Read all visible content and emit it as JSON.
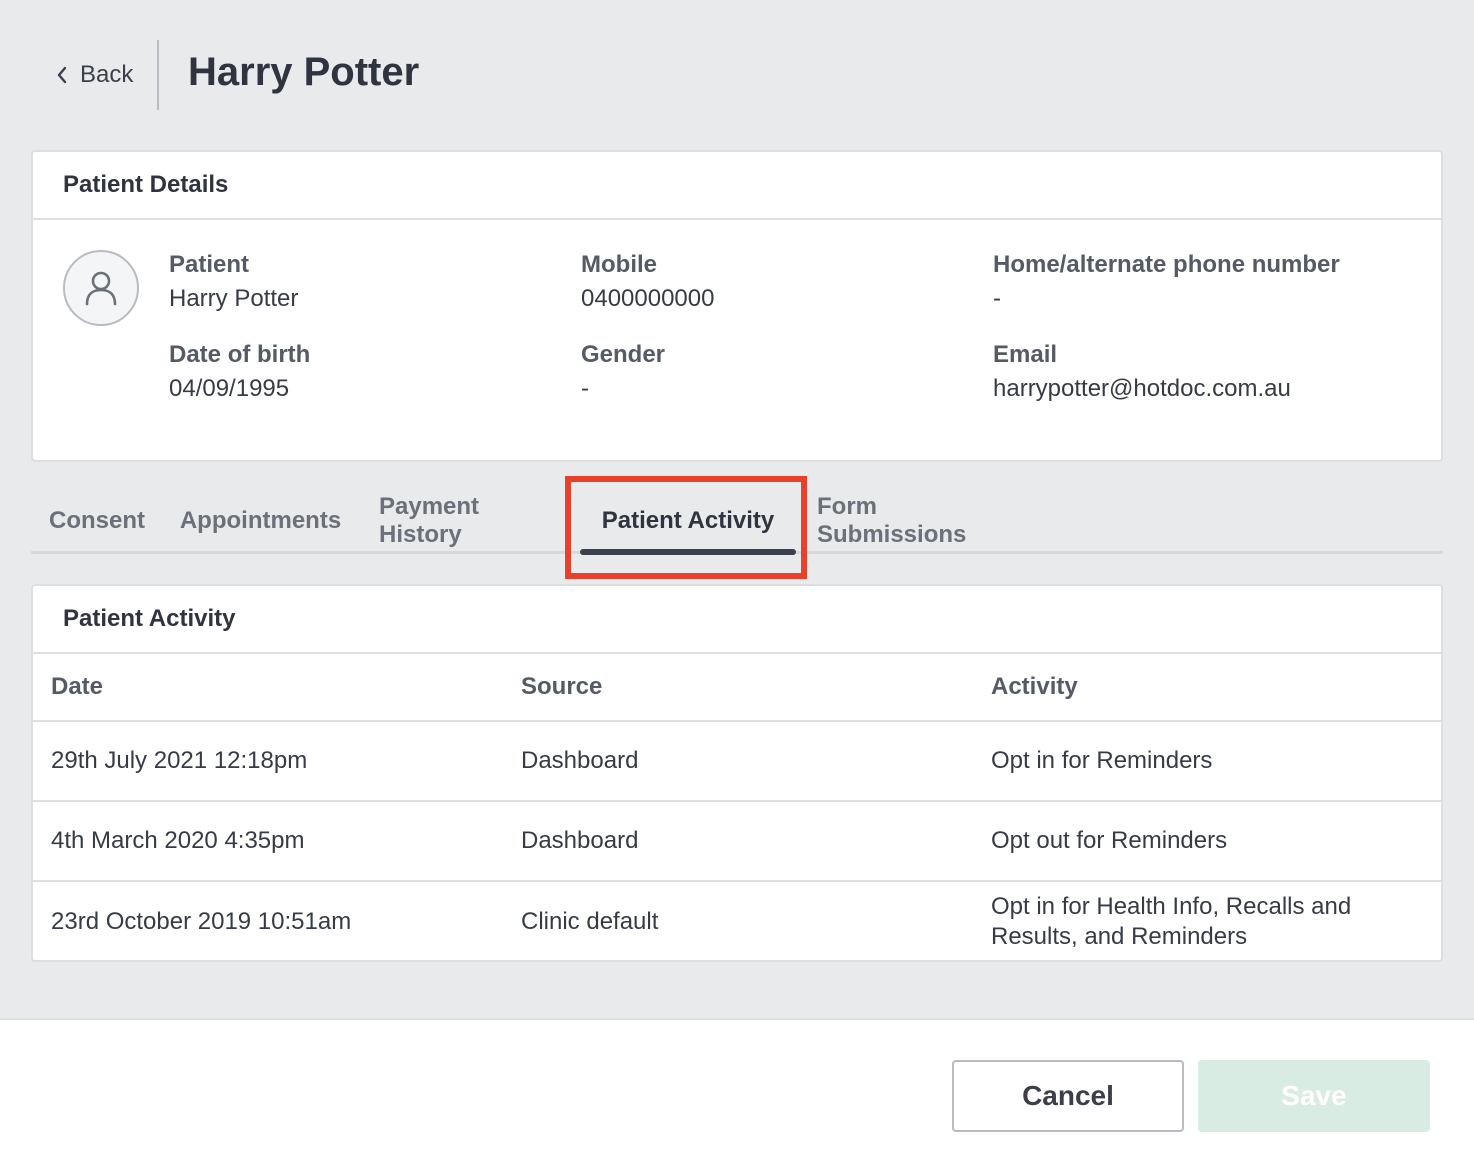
{
  "header": {
    "back_label": "Back",
    "title": "Harry Potter"
  },
  "patient_details": {
    "heading": "Patient Details",
    "fields": {
      "patient": {
        "label": "Patient",
        "value": "Harry Potter"
      },
      "mobile": {
        "label": "Mobile",
        "value": "0400000000"
      },
      "home_phone": {
        "label": "Home/alternate phone number",
        "value": "-"
      },
      "dob": {
        "label": "Date of birth",
        "value": "04/09/1995"
      },
      "gender": {
        "label": "Gender",
        "value": "-"
      },
      "email": {
        "label": "Email",
        "value": "harrypotter@hotdoc.com.au"
      }
    }
  },
  "tabs": [
    {
      "label": "Consent",
      "active": false
    },
    {
      "label": "Appointments",
      "active": false
    },
    {
      "label": "Payment History",
      "active": false
    },
    {
      "label": "Patient Activity",
      "active": true
    },
    {
      "label": "Form Submissions",
      "active": false
    }
  ],
  "activity": {
    "heading": "Patient Activity",
    "columns": [
      "Date",
      "Source",
      "Activity"
    ],
    "rows": [
      [
        "29th July 2021 12:18pm",
        "Dashboard",
        "Opt in for Reminders"
      ],
      [
        "4th March 2020 4:35pm",
        "Dashboard",
        "Opt out for Reminders"
      ],
      [
        "23rd October 2019 10:51am",
        "Clinic default",
        "Opt in for Health Info, Recalls and Results, and Reminders"
      ]
    ]
  },
  "footer": {
    "cancel_label": "Cancel",
    "save_label": "Save"
  },
  "colors": {
    "highlight": "#e8402a",
    "save_disabled": "#d9ece3",
    "background": "#e9eaec"
  },
  "icons": {
    "back": "chevron-left-icon",
    "avatar": "user-icon"
  }
}
